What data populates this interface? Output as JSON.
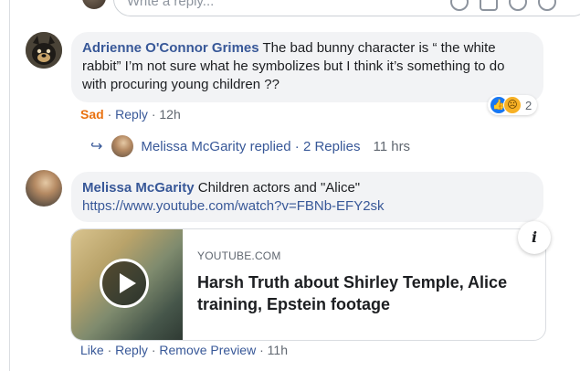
{
  "reply_box": {
    "placeholder": "Write a reply..."
  },
  "comment1": {
    "author": "Adrienne O'Connor Grimes",
    "text": "The bad bunny character is “ the white rabbit” I’m not sure what he symbolizes but I think it’s something to do with procuring young children ??",
    "reaction_count": "2",
    "reaction_icons": [
      "like-icon",
      "sad-icon"
    ],
    "actions": {
      "sad": "Sad",
      "reply": "Reply",
      "time": "12h"
    }
  },
  "replies_summary": {
    "text": "Melissa McGarity replied · 2 Replies",
    "time": "11 hrs"
  },
  "comment2": {
    "author": "Melissa McGarity",
    "text": "Children actors and \"Alice\"",
    "link": "https://www.youtube.com/watch?v=FBNb-EFY2sk",
    "preview": {
      "domain": "YOUTUBE.COM",
      "title": "Harsh Truth about Shirley Temple, Alice training, Epstein footage"
    },
    "actions": {
      "like": "Like",
      "reply": "Reply",
      "remove_preview": "Remove Preview",
      "time": "11h"
    }
  },
  "colors": {
    "link": "#385898",
    "sad_accent": "#e9710f",
    "bubble": "#f2f3f5"
  }
}
